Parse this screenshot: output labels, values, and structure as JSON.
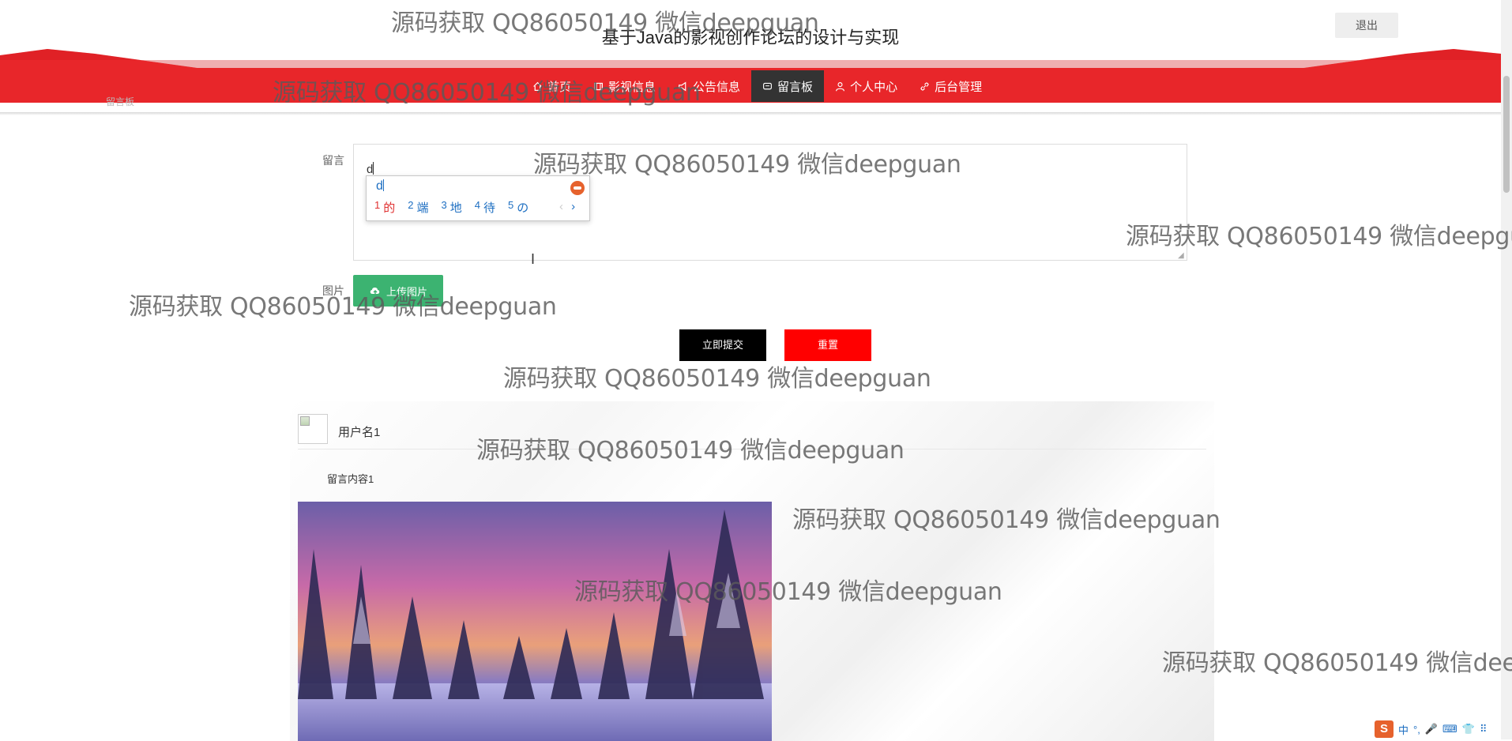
{
  "header": {
    "site_title": "基于Java的影视创作论坛的设计与实现",
    "logout_label": "退出",
    "breadcrumb_fragment": "留言板"
  },
  "nav": {
    "items": [
      {
        "label": "首页",
        "icon": "home-icon"
      },
      {
        "label": "影视信息",
        "icon": "film-icon"
      },
      {
        "label": "公告信息",
        "icon": "bullhorn-icon"
      },
      {
        "label": "留言板",
        "icon": "message-icon",
        "active": true
      },
      {
        "label": "个人中心",
        "icon": "user-icon"
      },
      {
        "label": "后台管理",
        "icon": "link-icon"
      }
    ]
  },
  "form": {
    "message_label": "留言",
    "message_value": "d",
    "image_label": "图片",
    "upload_label": "上传图片",
    "submit_label": "立即提交",
    "reset_label": "重置"
  },
  "ime": {
    "input": "d",
    "candidates": [
      {
        "num": "1",
        "text": "的"
      },
      {
        "num": "2",
        "text": "端"
      },
      {
        "num": "3",
        "text": "地"
      },
      {
        "num": "4",
        "text": "待"
      },
      {
        "num": "5",
        "text": "の"
      }
    ],
    "prev": "‹",
    "next": "›"
  },
  "messages": [
    {
      "username": "用户名1",
      "content": "留言内容1",
      "image": "snowy-forest-sunset-photo"
    }
  ],
  "watermark": "源码获取 QQ86050149 微信deepguan",
  "taskbar": {
    "ime_logo": "S",
    "items": [
      "中",
      "°,",
      "🎤",
      "⌨",
      "👕",
      "⠿"
    ]
  },
  "colors": {
    "nav_red": "#e8262a",
    "active_nav": "#333333",
    "submit": "#000000",
    "reset": "#ff0000",
    "upload": "#3cb371"
  }
}
